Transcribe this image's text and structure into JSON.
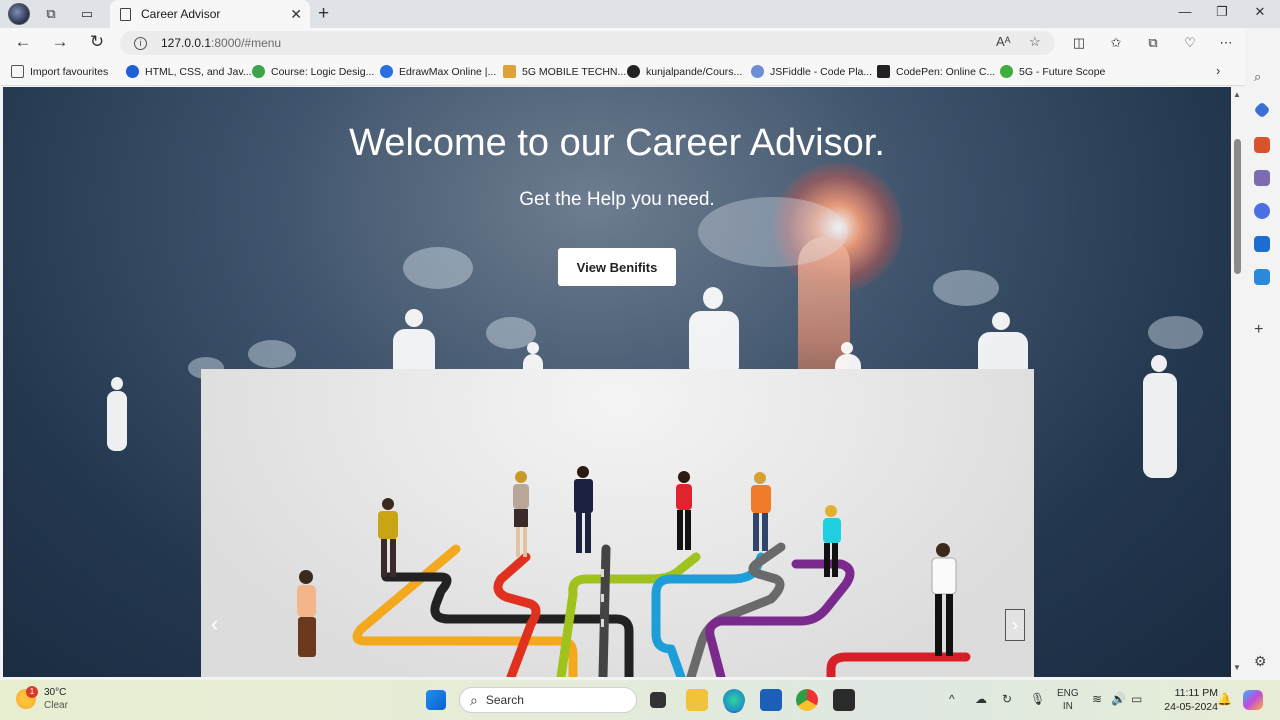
{
  "browser": {
    "tab": {
      "title": "Career Advisor"
    },
    "address": {
      "host": "127.0.0.1",
      "path": ":8000/#menu"
    },
    "bookmarks": [
      {
        "label": "Import favourites",
        "color": "#555555"
      },
      {
        "label": "HTML, CSS, and Jav...",
        "color": "#1f5fd6"
      },
      {
        "label": "Course: Logic Desig...",
        "color": "#3fa34d"
      },
      {
        "label": "EdrawMax Online |...",
        "color": "#2a6fe0"
      },
      {
        "label": "5G MOBILE TECHN...",
        "color": "#e0a03a"
      },
      {
        "label": "kunjalpande/Cours...",
        "color": "#222222"
      },
      {
        "label": "JSFiddle - Code Pla...",
        "color": "#6b8fd6"
      },
      {
        "label": "CodePen: Online C...",
        "color": "#222222"
      },
      {
        "label": "5G - Future Scope",
        "color": "#3fae3f"
      }
    ]
  },
  "hero": {
    "title": "Welcome to our Career Advisor.",
    "subtitle": "Get the Help you need.",
    "button": "View Benifits"
  },
  "carousel": {
    "prev": "‹",
    "next": "›"
  },
  "taskbar": {
    "weather": {
      "badge": "1",
      "temp": "30°C",
      "condition": "Clear"
    },
    "search_label": "Search",
    "lang": {
      "line1": "ENG",
      "line2": "IN"
    },
    "clock": {
      "time": "11:11 PM",
      "date": "24-05-2024"
    }
  }
}
